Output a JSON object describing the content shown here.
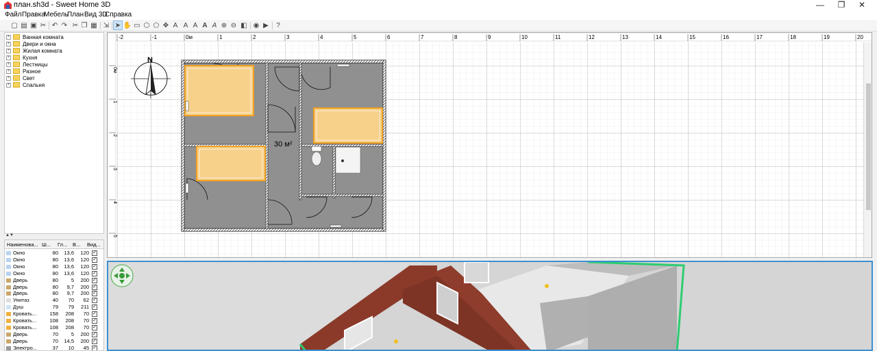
{
  "window": {
    "title": "план.sh3d - Sweet Home 3D",
    "minimize": "—",
    "maximize": "❐",
    "close": "✕"
  },
  "menu": [
    "Файл",
    "Правка",
    "Мебель",
    "План",
    "Вид 3D",
    "Справка"
  ],
  "catalog": {
    "categories": [
      "Ванная комната",
      "Двери и окна",
      "Жилая комната",
      "Кухня",
      "Лестницы",
      "Разное",
      "Свет",
      "Спальня"
    ]
  },
  "furniture_table": {
    "headers": [
      "Наименова...",
      "Ш...",
      "Гл...",
      "В...",
      "Вид..."
    ],
    "rows": [
      {
        "name": "Окно",
        "w": "80",
        "d": "13,6",
        "h": "120",
        "visible": true,
        "kind": "window"
      },
      {
        "name": "Окно",
        "w": "80",
        "d": "13,6",
        "h": "120",
        "visible": true,
        "kind": "window"
      },
      {
        "name": "Окно",
        "w": "80",
        "d": "13,6",
        "h": "120",
        "visible": true,
        "kind": "window"
      },
      {
        "name": "Окно",
        "w": "80",
        "d": "13,6",
        "h": "120",
        "visible": true,
        "kind": "window"
      },
      {
        "name": "Дверь",
        "w": "80",
        "d": "5",
        "h": "200",
        "visible": true,
        "kind": "door"
      },
      {
        "name": "Дверь",
        "w": "80",
        "d": "9,7",
        "h": "200",
        "visible": true,
        "kind": "door"
      },
      {
        "name": "Дверь",
        "w": "80",
        "d": "9,7",
        "h": "200",
        "visible": true,
        "kind": "door"
      },
      {
        "name": "Унитаз",
        "w": "40",
        "d": "70",
        "h": "62",
        "visible": true,
        "kind": "toilet"
      },
      {
        "name": "Душ",
        "w": "79",
        "d": "79",
        "h": "211",
        "visible": true,
        "kind": "shower"
      },
      {
        "name": "Кровать...",
        "w": "158",
        "d": "208",
        "h": "70",
        "visible": true,
        "kind": "bed"
      },
      {
        "name": "Кровать...",
        "w": "108",
        "d": "208",
        "h": "70",
        "visible": true,
        "kind": "bed"
      },
      {
        "name": "Кровать...",
        "w": "108",
        "d": "208",
        "h": "70",
        "visible": true,
        "kind": "bed"
      },
      {
        "name": "Дверь",
        "w": "70",
        "d": "5",
        "h": "200",
        "visible": true,
        "kind": "door"
      },
      {
        "name": "Дверь",
        "w": "70",
        "d": "14,5",
        "h": "200",
        "visible": true,
        "kind": "door"
      },
      {
        "name": "Электро...",
        "w": "37",
        "d": "10",
        "h": "45",
        "visible": true,
        "kind": "heater"
      }
    ]
  },
  "plan": {
    "ruler_x": [
      "-2",
      "-1",
      "0м",
      "1",
      "2",
      "3",
      "4",
      "5",
      "6",
      "7",
      "8",
      "9",
      "10",
      "11",
      "12",
      "13",
      "14",
      "15",
      "16",
      "17",
      "18",
      "19",
      "20"
    ],
    "ruler_y": [
      "0м",
      "1",
      "2",
      "3",
      "4",
      "5"
    ],
    "compass_label": "N",
    "area_label": "30 м²"
  },
  "colors": {
    "floor": "#8c8c8c",
    "bed": "#f7d08a",
    "bed_border": "#f0a020",
    "brick": "#8b3a2a",
    "selection": "#2ecc71"
  }
}
